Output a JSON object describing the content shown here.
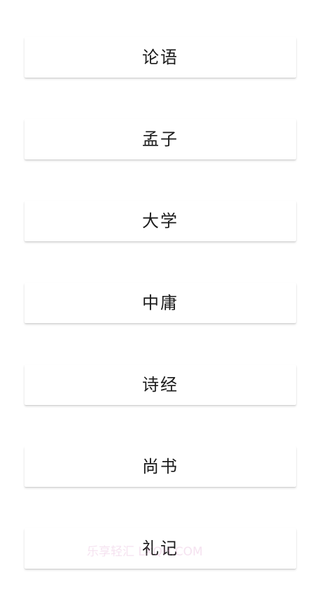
{
  "books": [
    {
      "label": "论语"
    },
    {
      "label": "孟子"
    },
    {
      "label": "大学"
    },
    {
      "label": "中庸"
    },
    {
      "label": "诗经"
    },
    {
      "label": "尚书"
    },
    {
      "label": "礼记"
    }
  ],
  "watermark": {
    "text": "乐享轻汇 LXQH.COM"
  }
}
